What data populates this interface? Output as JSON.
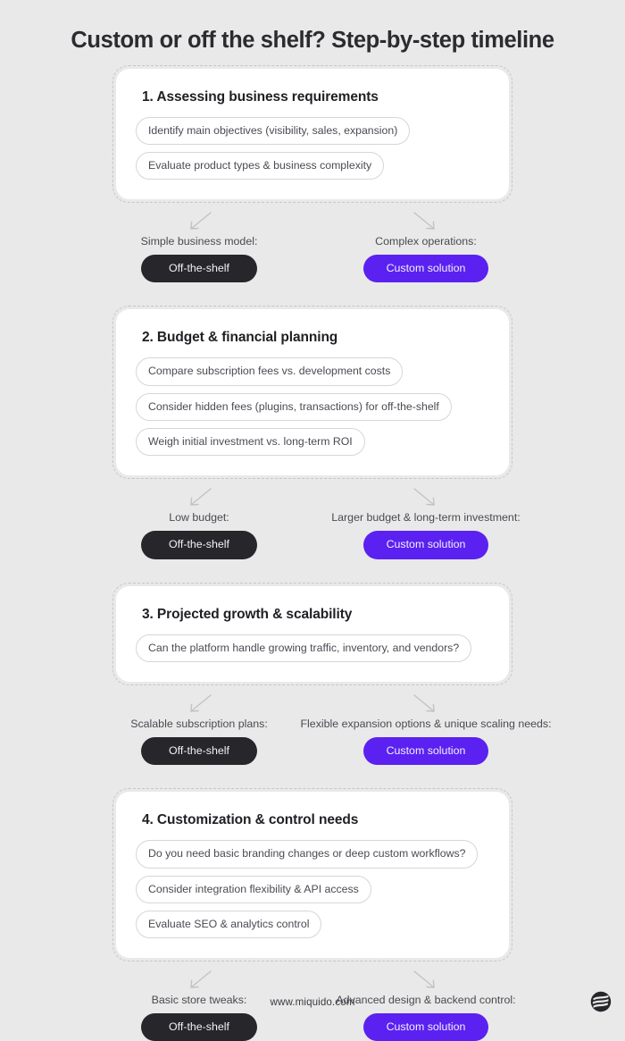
{
  "title": "Custom or off the shelf? Step-by-step timeline",
  "colors": {
    "background": "#e9e9e9",
    "card": "#ffffff",
    "card_border": "#c6c6c6",
    "heading": "#1f1f24",
    "chip_border": "#d6d6d6",
    "chip_text": "#4a4a52",
    "pill_dark": "#26262b",
    "pill_purple": "#5b21f0"
  },
  "icons": {
    "arrow_down_left": "arrow-down-left-icon",
    "arrow_down_right": "arrow-down-right-icon",
    "brand": "miquido-logo-icon"
  },
  "steps": [
    {
      "heading": "1. Assessing business requirements",
      "items": [
        "Identify main objectives (visibility, sales, expansion)",
        "Evaluate product types & business complexity"
      ],
      "branches": {
        "left": {
          "label": "Simple business model:",
          "pill": "Off-the-shelf",
          "style": "dark"
        },
        "right": {
          "label": "Complex operations:",
          "pill": "Custom solution",
          "style": "purple"
        }
      }
    },
    {
      "heading": "2. Budget & financial planning",
      "items": [
        "Compare subscription fees vs. development costs",
        "Consider hidden fees (plugins, transactions) for off-the-shelf",
        "Weigh initial investment vs. long-term ROI"
      ],
      "branches": {
        "left": {
          "label": "Low budget:",
          "pill": "Off-the-shelf",
          "style": "dark"
        },
        "right": {
          "label": "Larger budget & long-term investment:",
          "pill": "Custom solution",
          "style": "purple"
        }
      }
    },
    {
      "heading": "3. Projected growth & scalability",
      "items": [
        "Can the platform handle growing traffic, inventory, and vendors?"
      ],
      "branches": {
        "left": {
          "label": "Scalable subscription plans:",
          "pill": "Off-the-shelf",
          "style": "dark"
        },
        "right": {
          "label": "Flexible expansion options & unique scaling needs:",
          "pill": "Custom solution",
          "style": "purple"
        }
      }
    },
    {
      "heading": "4. Customization & control needs",
      "items": [
        "Do you need basic branding changes or deep custom workflows?",
        "Consider integration flexibility & API access",
        "Evaluate SEO & analytics control"
      ],
      "branches": {
        "left": {
          "label": "Basic store tweaks:",
          "pill": "Off-the-shelf",
          "style": "dark"
        },
        "right": {
          "label": "Advanced design & backend control:",
          "pill": "Custom solution",
          "style": "purple"
        }
      }
    }
  ],
  "footer": {
    "url": "www.miquido.com"
  }
}
